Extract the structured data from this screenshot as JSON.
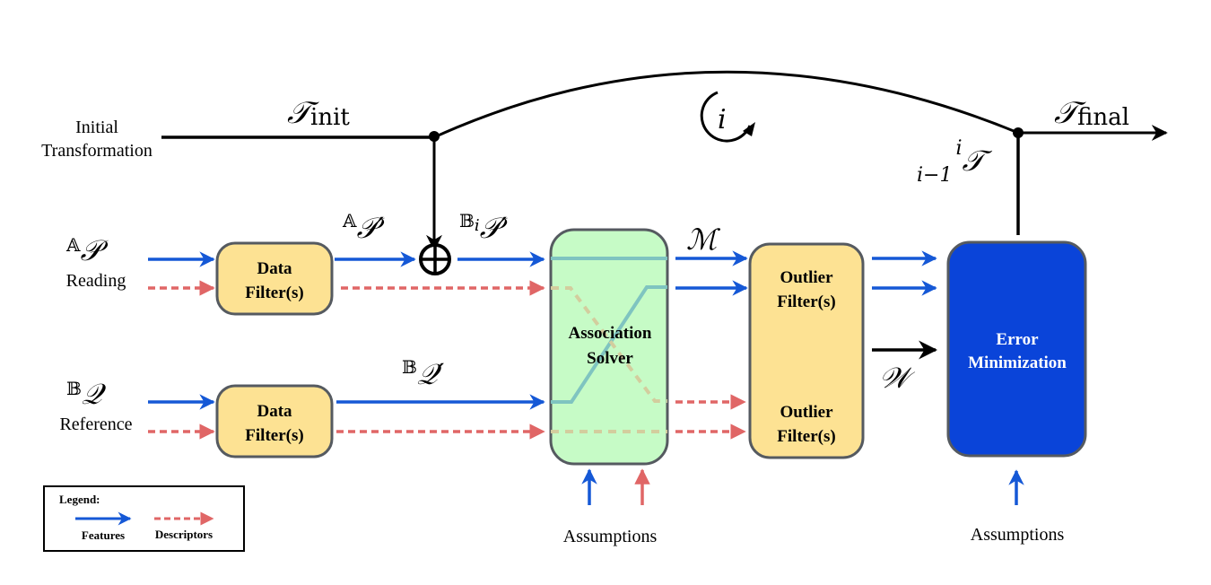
{
  "top": {
    "initial_line1": "Initial",
    "initial_line2": "Transformation",
    "t_init_symbol": "𝒯",
    "t_init_sub": "init",
    "loop_symbol": "i",
    "t_final_symbol": "𝒯",
    "t_final_sub": "final",
    "t_step_pre": "i−1",
    "t_step_sup": "i",
    "t_step_symbol": "𝒯"
  },
  "inputs": {
    "reading_symbol_sup": "𝔸",
    "reading_symbol": "𝒫",
    "reading_label": "Reading",
    "reference_symbol_sup": "𝔹",
    "reference_symbol": "𝒬",
    "reference_label": "Reference"
  },
  "signals": {
    "a_p_prime_sup": "𝔸",
    "a_p_prime": "𝒫′",
    "bi_p_prime_sup": "𝔹",
    "bi_p_prime_sub": "i",
    "bi_p_prime": "𝒫′",
    "b_q_prime_sup": "𝔹",
    "b_q_prime": "𝒬′",
    "matches": "ℳ",
    "weights": "𝒲",
    "plus": "⊕"
  },
  "blocks": {
    "data_filter_line1": "Data",
    "data_filter_line2": "Filter(s)",
    "association_line1": "Association",
    "association_line2": "Solver",
    "outlier_line1": "Outlier",
    "outlier_line2": "Filter(s)",
    "error_line1": "Error",
    "error_line2": "Minimization",
    "assumptions": "Assumptions"
  },
  "legend": {
    "title": "Legend:",
    "features": "Features",
    "descriptors": "Descriptors"
  },
  "colors": {
    "features": "#1558d6",
    "descriptors": "#e06666",
    "data_filter_fill": "#fde293",
    "association_fill": "#c6fbc6",
    "outlier_fill": "#fde293",
    "error_fill": "#0a44d9",
    "box_stroke": "#555a60"
  }
}
